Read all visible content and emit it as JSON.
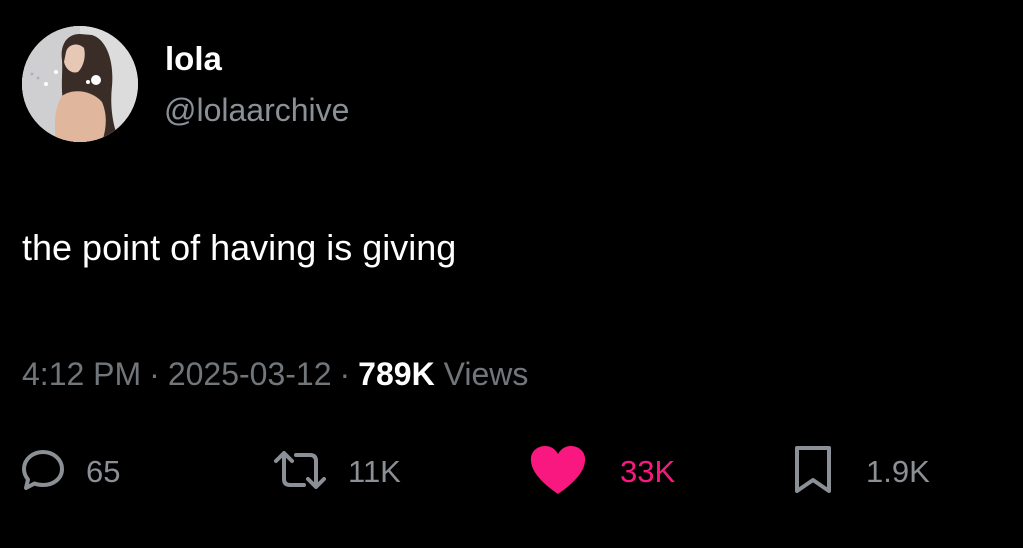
{
  "author": {
    "display_name": "lola",
    "handle": "@lolaarchive",
    "avatar_icon": "profile-photo"
  },
  "tweet": {
    "text": "the point of having is giving"
  },
  "meta": {
    "time": "4:12 PM",
    "separator": "·",
    "date": "2025-03-12",
    "views_count": "789K",
    "views_label": "Views"
  },
  "actions": {
    "reply": {
      "icon": "reply-icon",
      "count": "65"
    },
    "retweet": {
      "icon": "retweet-icon",
      "count": "11K"
    },
    "like": {
      "icon": "heart-icon",
      "count": "33K",
      "liked": true
    },
    "bookmark": {
      "icon": "bookmark-icon",
      "count": "1.9K"
    }
  },
  "colors": {
    "background": "#000000",
    "text_primary": "#ffffff",
    "text_secondary": "#71767b",
    "like_accent": "#f91880"
  }
}
